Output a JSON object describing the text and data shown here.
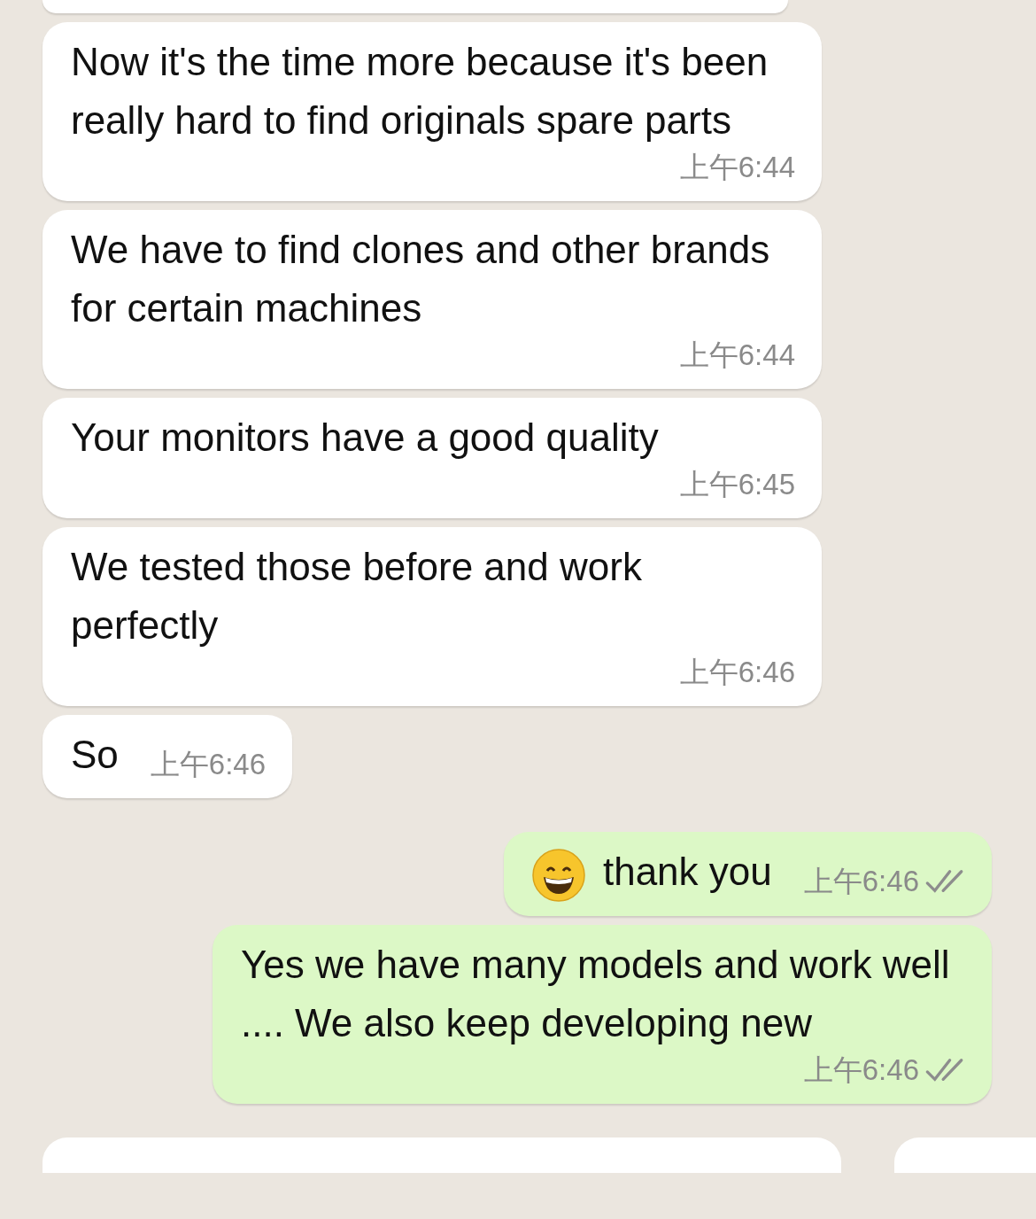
{
  "messages": [
    {
      "kind": "incoming",
      "text": "Now it's the time more because it's been really hard to find originals spare parts",
      "time": "上午6:44"
    },
    {
      "kind": "incoming",
      "text": "We have to find clones and other brands for certain machines",
      "time": "上午6:44"
    },
    {
      "kind": "incoming",
      "text": "Your monitors have a good quality",
      "time": "上午6:45"
    },
    {
      "kind": "incoming",
      "text": "We tested those before and work perfectly",
      "time": "上午6:46"
    },
    {
      "kind": "incoming",
      "text": "So",
      "time": "上午6:46"
    },
    {
      "kind": "outgoing",
      "emoji": true,
      "text": "thank you",
      "time": "上午6:46",
      "read": false
    },
    {
      "kind": "outgoing",
      "text": "Yes we have many models and work well .... We also keep developing new",
      "time": "上午6:46",
      "read": false
    }
  ]
}
